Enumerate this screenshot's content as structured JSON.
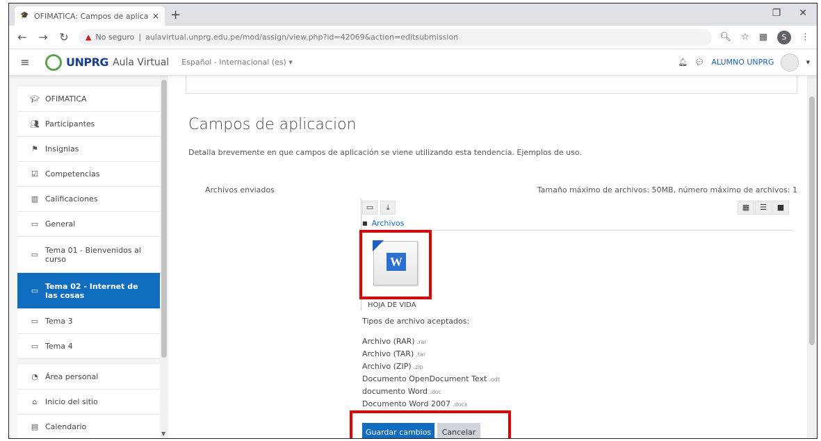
{
  "browser": {
    "tab_title": "OFIMATICA: Campos de aplicacion",
    "tab_close": "×",
    "new_tab": "+",
    "insecure_label": "No seguro",
    "url": "aulavirtual.unprg.edu.pe/mod/assign/view.php?id=42069&action=editsubmission",
    "profile_initial": "S"
  },
  "navbar": {
    "logo_text": "UNPRG",
    "logo_sub": "Aula Virtual",
    "language": "Español - Internacional (es)",
    "user_name": "ALUMNO UNPRG"
  },
  "sidebar": {
    "items": [
      {
        "label": "OFIMATICA",
        "icon": "graduation-cap-icon"
      },
      {
        "label": "Participantes",
        "icon": "users-icon"
      },
      {
        "label": "Insignias",
        "icon": "badge-icon"
      },
      {
        "label": "Competencias",
        "icon": "checklist-icon"
      },
      {
        "label": "Calificaciones",
        "icon": "table-icon"
      },
      {
        "label": "General",
        "icon": "folder-icon"
      },
      {
        "label": "Tema 01 - Bienvenidos al curso",
        "icon": "folder-icon"
      },
      {
        "label": "Tema 02 - Internet de las cosas",
        "icon": "folder-icon",
        "active": true
      },
      {
        "label": "Tema 3",
        "icon": "folder-icon"
      },
      {
        "label": "Tema 4",
        "icon": "folder-icon"
      },
      {
        "label": "Área personal",
        "icon": "dashboard-icon"
      },
      {
        "label": "Inicio del sitio",
        "icon": "home-icon"
      },
      {
        "label": "Calendario",
        "icon": "calendar-icon"
      }
    ]
  },
  "main": {
    "title": "Campos de aplicacion",
    "description": "Detalla brevemente en que campos de aplicación se viene utilizando esta tendencia. Ejemplos de uso.",
    "files_label": "Archivos enviados",
    "max_info": "Tamaño máximo de archivos: 50MB, número máximo de archivos: 1",
    "path_label": "Archivos",
    "file_name": "HOJA DE VIDA",
    "accepted_title": "Tipos de archivo aceptados:",
    "accepted_types": [
      {
        "name": "Archivo (RAR)",
        "ext": ".rar"
      },
      {
        "name": "Archivo (TAR)",
        "ext": ".tar"
      },
      {
        "name": "Archivo (ZIP)",
        "ext": ".zip"
      },
      {
        "name": "Documento OpenDocument Text",
        "ext": ".odt"
      },
      {
        "name": "documento Word",
        "ext": ".doc"
      },
      {
        "name": "Documento Word 2007",
        "ext": ".docx"
      }
    ],
    "save_label": "Guardar cambios",
    "cancel_label": "Cancelar"
  },
  "colors": {
    "accent": "#0f6cbf",
    "highlight": "#e30000"
  }
}
